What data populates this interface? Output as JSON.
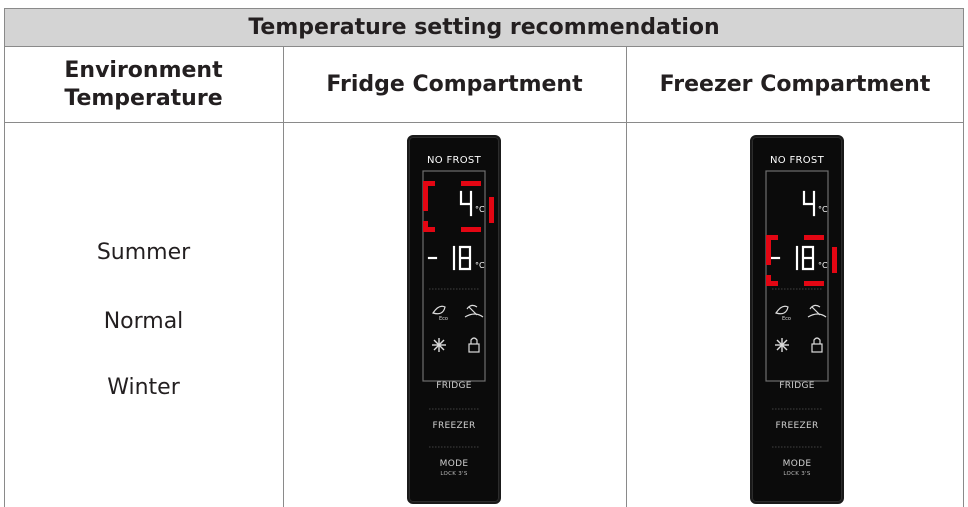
{
  "table": {
    "title": "Temperature setting recommendation",
    "headers": {
      "environment_line1": "Environment",
      "environment_line2": "Temperature",
      "fridge": "Fridge Compartment",
      "freezer": "Freezer Compartment"
    },
    "environment_rows": [
      "Summer",
      "Normal",
      "Winter"
    ]
  },
  "panels": [
    {
      "brand": "NO FROST",
      "fridge_display": "4",
      "freezer_display": "- 18",
      "unit": "°C",
      "highlighted": "fridge",
      "buttons": {
        "fridge": "FRIDGE",
        "freezer": "FREEZER",
        "mode": "MODE",
        "mode_sub": "LOCK 3'S"
      },
      "icons": [
        "eco-leaf-icon",
        "holiday-beach-icon",
        "snowflake-icon",
        "lock-icon"
      ]
    },
    {
      "brand": "NO FROST",
      "fridge_display": "4",
      "freezer_display": "- 18",
      "unit": "°C",
      "highlighted": "freezer",
      "buttons": {
        "fridge": "FRIDGE",
        "freezer": "FREEZER",
        "mode": "MODE",
        "mode_sub": "LOCK 3'S"
      },
      "icons": [
        "eco-leaf-icon",
        "holiday-beach-icon",
        "snowflake-icon",
        "lock-icon"
      ]
    }
  ],
  "colors": {
    "highlight": "#e30613",
    "title_band": "#d4d4d4",
    "panel": "#0b0b0b"
  }
}
